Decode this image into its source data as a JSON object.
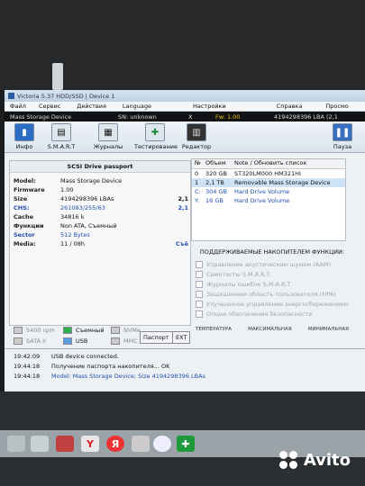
{
  "window": {
    "title": "Victoria 5.37 HDD/SSD | Device 1"
  },
  "menu": [
    "Файл",
    "Сервис",
    "Действия",
    "Language",
    "Настройки",
    "Справка",
    "Просмо"
  ],
  "device_bar": {
    "name": "Mass  Storage Device",
    "sn": "SN: unknown",
    "close": "X",
    "fw": "Fw: 1.00",
    "lba": "4194298396 LBA (2,1"
  },
  "toolbar": {
    "info": "Инфо",
    "smart": "S.M.A.R.T",
    "logs": "Журналы",
    "test": "Тестирование",
    "editor": "Редактор",
    "pause": "Пауза"
  },
  "passport": {
    "title": "SCSI  Drive passport",
    "rows": [
      {
        "k": "Model:",
        "v": "Mass  Storage Device",
        "r": ""
      },
      {
        "k": "Firmware",
        "v": "1.00",
        "r": ""
      },
      {
        "k": "Size",
        "v": "4194298396 LBAs",
        "r": "2,1"
      },
      {
        "k": "CHS:",
        "v": "261083/255/63",
        "r": "2,1"
      },
      {
        "k": "Cache",
        "v": "34816 k",
        "r": ""
      },
      {
        "k": "Функции",
        "v": "Non ATA, Съемный",
        "r": ""
      },
      {
        "k": "Sector",
        "v": "512 Bytes",
        "r": ""
      },
      {
        "k": "Media:",
        "v": "11 / 08h",
        "r": "Съё"
      }
    ]
  },
  "drive_list": {
    "headers": [
      "№",
      "Объем",
      "Note / Обновить список"
    ],
    "rows": [
      {
        "n": "0",
        "size": "320 GB",
        "note": "ST320LM000 HM321HI"
      },
      {
        "n": "1",
        "size": "2,1 TB",
        "note": "Removable Mass  Storage Device"
      },
      {
        "n": "C:",
        "size": "304 GB",
        "note": "Hard Drive Volume"
      },
      {
        "n": "Y:",
        "size": "16 GB",
        "note": "Hard Drive Volume"
      }
    ]
  },
  "features": {
    "title": "ПОДДЕРЖИВАЕМЫЕ НАКОПИТЕЛЕМ ФУНКЦИИ:",
    "items": [
      "Управление акустическим шумом (AAM)",
      "Самотесты S.M.A.R.T.",
      "Журналы ошибок S.M.A.R.T.",
      "Защищенная область пользователя (HPA)",
      "Улучшенное управление энергосбережением",
      "Опции обеспечения безопасности"
    ]
  },
  "legend": {
    "rpm": "5400 rpm",
    "removable": "Съемный",
    "nvme": "NVMe",
    "sata": "SATA II",
    "usb": "USB",
    "mmc": "MMC"
  },
  "buttons": {
    "passport": "Паспорт",
    "ext": "EXT"
  },
  "temps": {
    "t": "ТЕМПЕРАТУРА",
    "max": "МАКСИМАЛЬНАЯ",
    "min": "МИНИМАЛЬНАЯ"
  },
  "log": [
    {
      "time": "19:42:09",
      "msg": "USB device connected."
    },
    {
      "time": "19:44:18",
      "msg": "Получение паспорта накопителя... OK"
    },
    {
      "time": "19:44:18",
      "msg": "Model: Mass  Storage Device; Size 4194298396 LBAs"
    }
  ],
  "taskbar_icons": [
    "Y",
    "Я"
  ],
  "watermark": "Avito",
  "colors": {
    "accent_blue": "#1f4fb0",
    "selected_row": "#cfe3f7",
    "fw_yellow": "#f0c000"
  }
}
